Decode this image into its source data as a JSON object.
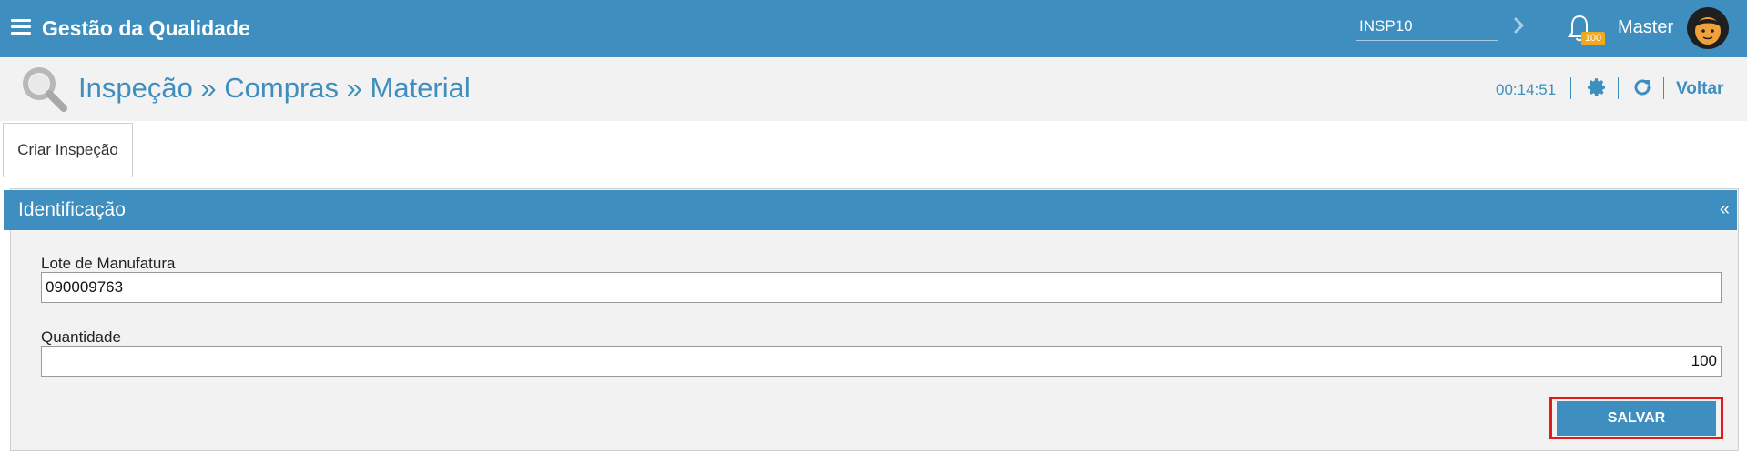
{
  "topbar": {
    "title": "Gestão da Qualidade",
    "search_value": "INSP10",
    "notification_count": "100",
    "user_name": "Master"
  },
  "crumbbar": {
    "breadcrumb": "Inspeção » Compras » Material",
    "timer": "00:14:51",
    "back_label": "Voltar"
  },
  "tabs": [
    {
      "label": "Criar Inspeção"
    }
  ],
  "panel": {
    "title": "Identificação",
    "collapse_symbol": "«",
    "fields": [
      {
        "label": "Lote de Manufatura",
        "value": "090009763"
      },
      {
        "label": "Quantidade",
        "value": "100"
      }
    ],
    "save_label": "SALVAR"
  },
  "colors": {
    "primary": "#3e8ebf",
    "badge": "#f0a91c",
    "highlight": "#e11b1b",
    "panel_bg": "#f2f2f2"
  },
  "icons": [
    "menu-icon",
    "chevron-right-icon",
    "bell-icon",
    "avatar",
    "magnifier-icon",
    "gear-icon",
    "refresh-icon"
  ]
}
